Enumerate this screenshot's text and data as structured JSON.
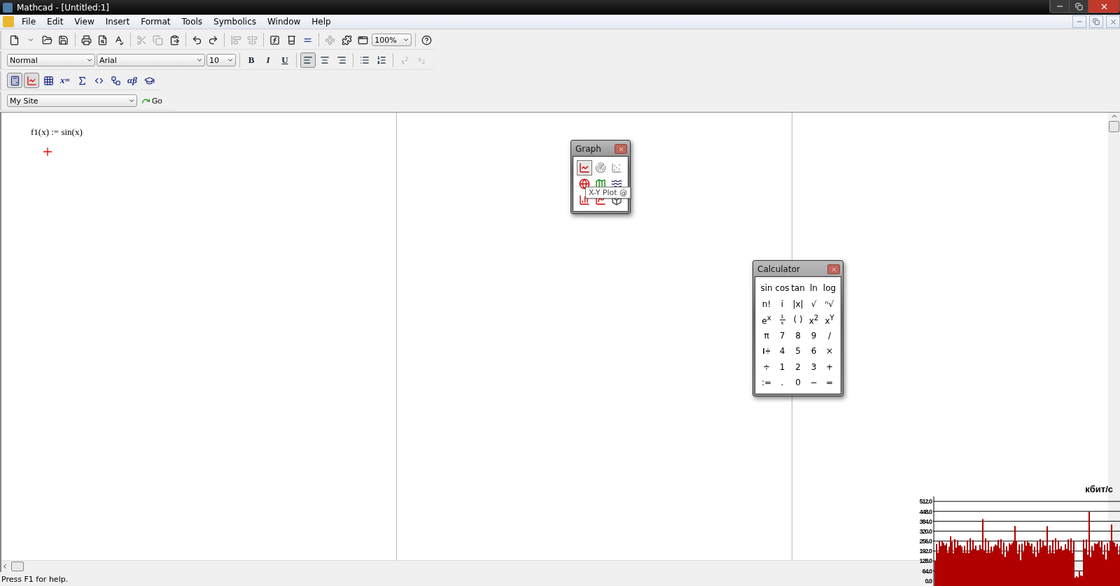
{
  "window": {
    "title": "Mathcad - [Untitled:1]"
  },
  "menu": [
    {
      "label": "File"
    },
    {
      "label": "Edit"
    },
    {
      "label": "View"
    },
    {
      "label": "Insert"
    },
    {
      "label": "Format"
    },
    {
      "label": "Tools"
    },
    {
      "label": "Symbolics"
    },
    {
      "label": "Window"
    },
    {
      "label": "Help"
    }
  ],
  "standard_toolbar": {
    "buttons": [
      {
        "disabled": false
      },
      {
        "disabled": false
      },
      {
        "disabled": false
      },
      {
        "disabled": false
      },
      {
        "disabled": false
      },
      {
        "disabled": false
      },
      {
        "disabled": false
      },
      {
        "disabled": true
      },
      {
        "disabled": true
      },
      {
        "disabled": false
      },
      {
        "disabled": false
      },
      {
        "disabled": false
      },
      {
        "disabled": true
      },
      {
        "disabled": true
      },
      {
        "disabled": false
      },
      {
        "disabled": false
      },
      {
        "disabled": false
      },
      {
        "disabled": true
      },
      {
        "disabled": false
      },
      {
        "disabled": false
      },
      {
        "disabled": false
      }
    ],
    "zoom": "100%"
  },
  "formatting_toolbar": {
    "style": "Normal",
    "font": "Arial",
    "size": "10",
    "buttons": [
      {
        "label": "B",
        "disabled": false,
        "selected": false
      },
      {
        "label": "I",
        "disabled": false,
        "selected": false
      },
      {
        "label": "U",
        "disabled": false,
        "selected": false
      },
      {
        "disabled": false,
        "selected": true
      },
      {
        "disabled": false,
        "selected": false
      },
      {
        "disabled": false,
        "selected": false
      },
      {
        "disabled": false,
        "selected": false
      },
      {
        "disabled": false,
        "selected": false
      },
      {
        "label": "x$^{2}$",
        "disabled": true,
        "selected": false
      },
      {
        "label": "x$_{2}$",
        "disabled": true,
        "selected": false
      }
    ]
  },
  "math_toolbar": [
    {
      "selected": true
    },
    {
      "selected": true
    },
    {
      "selected": false
    },
    {
      "selected": false,
      "label": "x="
    },
    {
      "selected": false
    },
    {
      "selected": false
    },
    {
      "selected": false
    },
    {
      "selected": false,
      "label": "αβ"
    },
    {
      "selected": false
    }
  ],
  "web_toolbar": {
    "address": "My Site",
    "go": "Go"
  },
  "worksheet": {
    "expression": "f1(x) := sin(x)"
  },
  "graph_palette": {
    "title": "Graph",
    "buttons": [
      {
        "selected": true
      },
      {
        "selected": false
      },
      {
        "selected": false
      },
      {
        "selected": false
      },
      {
        "selected": false
      },
      {
        "selected": false
      },
      {
        "selected": false
      },
      {
        "selected": false
      },
      {
        "selected": false
      }
    ],
    "tooltip": "X-Y Plot @"
  },
  "calculator": {
    "title": "Calculator",
    "keys": [
      {
        "kind": "text",
        "label": "sin"
      },
      {
        "kind": "text",
        "label": "cos"
      },
      {
        "kind": "text",
        "label": "tan"
      },
      {
        "kind": "text",
        "label": "ln"
      },
      {
        "kind": "text",
        "label": "log"
      },
      {
        "kind": "text",
        "label": "n!"
      },
      {
        "kind": "text",
        "label": "i"
      },
      {
        "kind": "text",
        "label": "|x|"
      },
      {
        "kind": "text",
        "label": "√"
      },
      {
        "kind": "text",
        "label": "ⁿ√"
      },
      {
        "kind": "text",
        "label": "e$^{x}$"
      },
      {
        "kind": "fraction",
        "num": "1",
        "den": "x"
      },
      {
        "kind": "text",
        "label": "( )"
      },
      {
        "kind": "text",
        "label": "x$^{2}$"
      },
      {
        "kind": "text",
        "label": "x$^{Y}$"
      },
      {
        "kind": "text",
        "label": "π"
      },
      {
        "kind": "text",
        "label": "7"
      },
      {
        "kind": "text",
        "label": "8"
      },
      {
        "kind": "text",
        "label": "9"
      },
      {
        "kind": "text",
        "label": "/"
      },
      {
        "kind": "mixed"
      },
      {
        "kind": "text",
        "label": "4"
      },
      {
        "kind": "text",
        "label": "5"
      },
      {
        "kind": "text",
        "label": "6"
      },
      {
        "kind": "text",
        "label": "×"
      },
      {
        "kind": "text",
        "label": "÷"
      },
      {
        "kind": "text",
        "label": "1"
      },
      {
        "kind": "text",
        "label": "2"
      },
      {
        "kind": "text",
        "label": "3"
      },
      {
        "kind": "text",
        "label": "+"
      },
      {
        "kind": "text",
        "label": ":="
      },
      {
        "kind": "text",
        "label": "."
      },
      {
        "kind": "text",
        "label": "0"
      },
      {
        "kind": "text",
        "label": "−"
      },
      {
        "kind": "text",
        "label": "="
      }
    ]
  },
  "status_bar": {
    "text": "Press F1 for help."
  },
  "traffic_meter": {
    "unit": "кбит/с",
    "tick_labels": [
      "512.0",
      "448.0",
      "384.0",
      "320.0",
      "256.0",
      "192.0",
      "128.0",
      "64.0",
      "0.0"
    ]
  }
}
